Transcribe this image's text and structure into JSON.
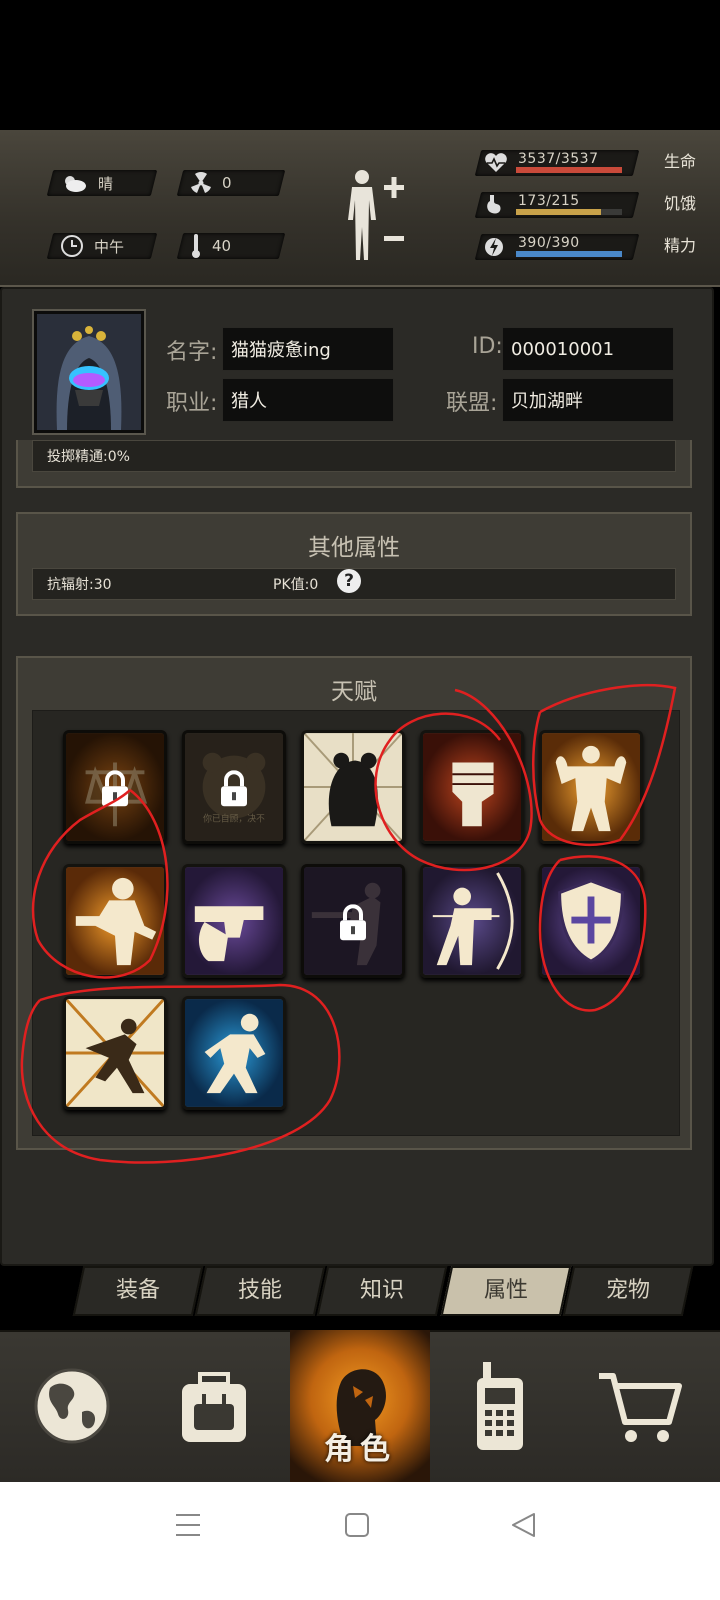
{
  "status": {
    "weather": "晴",
    "radiation": "0",
    "time_of_day": "中午",
    "temperature": "40",
    "health": {
      "value": "3537/3537",
      "label": "生命",
      "fraction": 1.0,
      "color": "#c94a3a"
    },
    "hunger": {
      "value": "173/215",
      "label": "饥饿",
      "fraction": 0.8,
      "color": "#c9a24a"
    },
    "energy": {
      "value": "390/390",
      "label": "精力",
      "fraction": 1.0,
      "color": "#4a88c9"
    }
  },
  "profile": {
    "name_label": "名字:",
    "name_value": "猫猫疲惫ing",
    "job_label": "职业:",
    "job_value": "猎人",
    "id_label": "ID:",
    "id_value": "000010001",
    "alliance_label": "联盟:",
    "alliance_value": "贝加湖畔"
  },
  "prev_section": {
    "row_text": "投掷精通:0%"
  },
  "other_attributes": {
    "title": "其他属性",
    "radiation_resist": "抗辐射:30",
    "pk_value": "PK值:0",
    "help_icon": "question-icon"
  },
  "talents": {
    "title": "天赋",
    "items": [
      {
        "icon": "porter-icon",
        "locked": true,
        "theme": "orange"
      },
      {
        "icon": "bear-icon",
        "locked": true,
        "theme": "dark",
        "caption": "你已自顾，决不"
      },
      {
        "icon": "bear-fight-icon",
        "locked": false,
        "theme": "light"
      },
      {
        "icon": "fist-icon",
        "locked": false,
        "theme": "red"
      },
      {
        "icon": "muscle-icon",
        "locked": false,
        "theme": "orange"
      },
      {
        "icon": "boxer-icon",
        "locked": false,
        "theme": "orange"
      },
      {
        "icon": "pistol-icon",
        "locked": false,
        "theme": "purple"
      },
      {
        "icon": "rifle-icon",
        "locked": true,
        "theme": "purple-dark"
      },
      {
        "icon": "archer-icon",
        "locked": false,
        "theme": "purple"
      },
      {
        "icon": "shield-icon",
        "locked": false,
        "theme": "purple"
      },
      {
        "icon": "dodge-icon",
        "locked": false,
        "theme": "orange"
      },
      {
        "icon": "crouch-icon",
        "locked": false,
        "theme": "blue"
      }
    ]
  },
  "tabs": [
    "装备",
    "技能",
    "知识",
    "属性",
    "宠物"
  ],
  "active_tab": "属性",
  "nav": {
    "items": [
      "globe-icon",
      "backpack-icon",
      "character-icon",
      "radio-icon",
      "cart-icon"
    ],
    "active_label": "角色"
  },
  "colors": {
    "accent": "#f29a22",
    "panel": "#3e3c35",
    "annotation": "#e02020"
  }
}
